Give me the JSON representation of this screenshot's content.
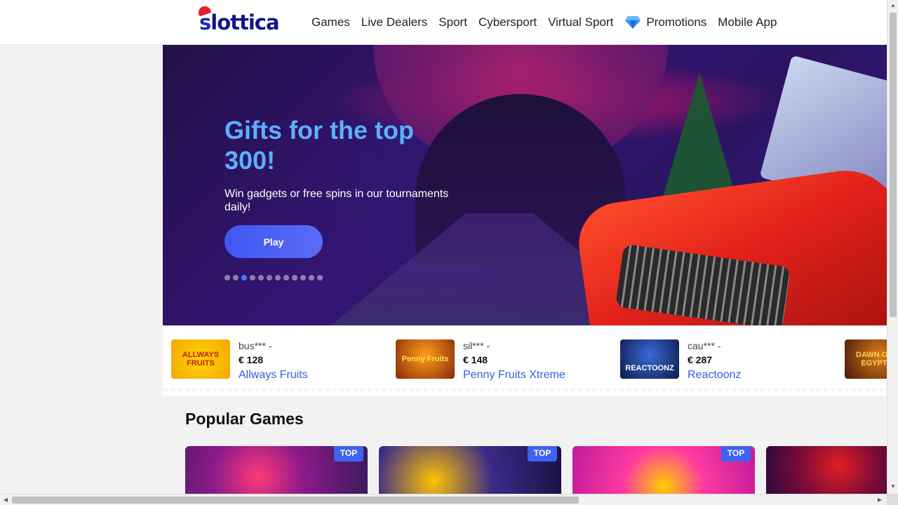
{
  "header": {
    "logo_text_first": "s",
    "logo_text_rest": "lottica",
    "nav": [
      {
        "label": "Games"
      },
      {
        "label": "Live Dealers"
      },
      {
        "label": "Sport"
      },
      {
        "label": "Cybersport"
      },
      {
        "label": "Virtual Sport"
      },
      {
        "label": "Promotions",
        "icon": "diamond-icon"
      },
      {
        "label": "Mobile App"
      }
    ]
  },
  "hero": {
    "title": "Gifts for the top 300!",
    "subtitle": "Win gadgets or free spins in our tournaments daily!",
    "button_label": "Play",
    "slides_count": 12,
    "active_slide_index": 2
  },
  "winners": [
    {
      "user": "bus*** -",
      "amount": "€ 128",
      "game": "Allways Fruits",
      "thumb_text": "ALLWAYS FRUITS"
    },
    {
      "user": "sil*** -",
      "amount": "€ 148",
      "game": "Penny Fruits Xtreme",
      "thumb_text": "Penny Fruits"
    },
    {
      "user": "cau*** -",
      "amount": "€ 287",
      "game": "Reactoonz",
      "thumb_text": "REACTOONZ"
    },
    {
      "user": "",
      "amount": "",
      "game": "",
      "thumb_text": "DAWN OF EGYPT"
    }
  ],
  "popular": {
    "title": "Popular Games",
    "badge_label": "TOP"
  },
  "colors": {
    "accent_blue": "#3e63f0",
    "link_blue": "#2f5fe0",
    "hero_title": "#5ab0ff"
  }
}
